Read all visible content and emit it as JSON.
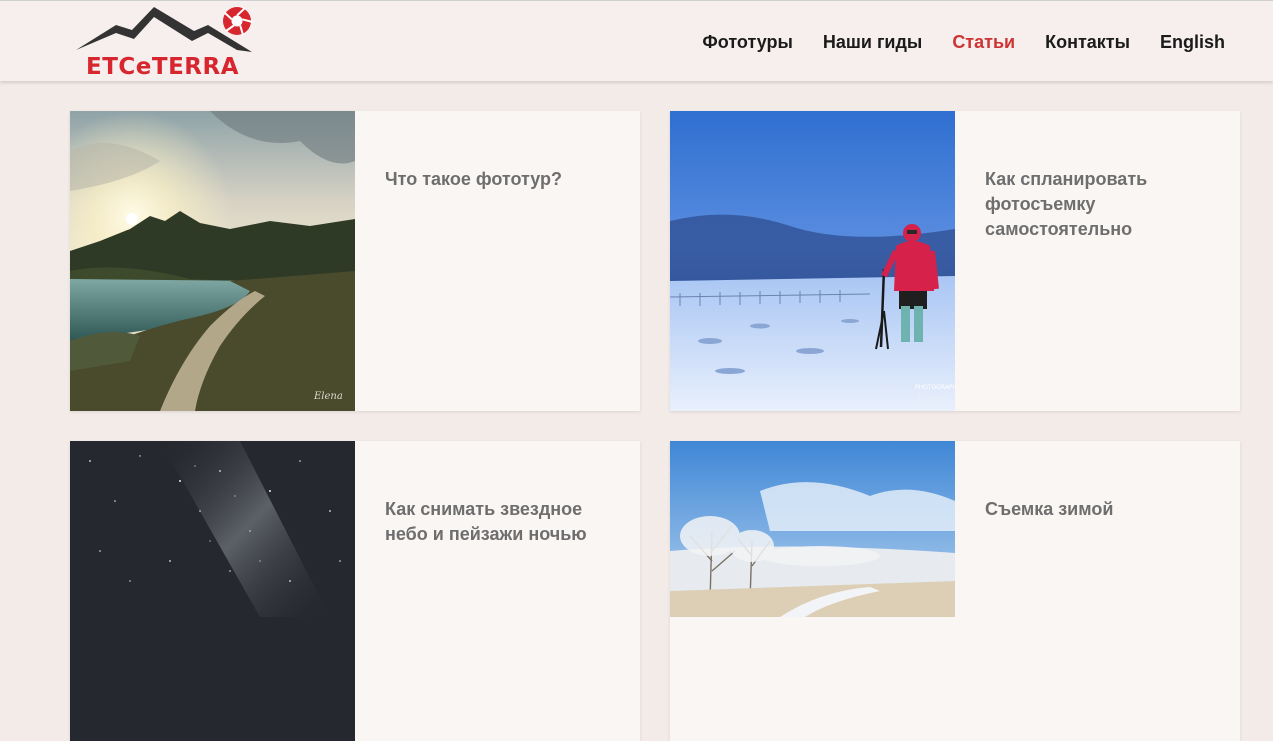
{
  "site": {
    "logo_text": "ETCeTERRA",
    "brand_color": "#d8262f"
  },
  "nav": {
    "items": [
      {
        "label": "Фототуры",
        "active": false
      },
      {
        "label": "Наши гиды",
        "active": false
      },
      {
        "label": "Статьи",
        "active": true
      },
      {
        "label": "Контакты",
        "active": false
      },
      {
        "label": "English",
        "active": false
      }
    ],
    "active_color": "#cc3434"
  },
  "articles": [
    {
      "title": "Что такое фототур?",
      "watermark": "Elena"
    },
    {
      "title": "Как спланировать фотосъемку самостоятельно",
      "watermark": "Elena"
    },
    {
      "title": "Как снимать звездное небо и пейзажи ночью"
    },
    {
      "title": "Съемка зимой"
    }
  ]
}
